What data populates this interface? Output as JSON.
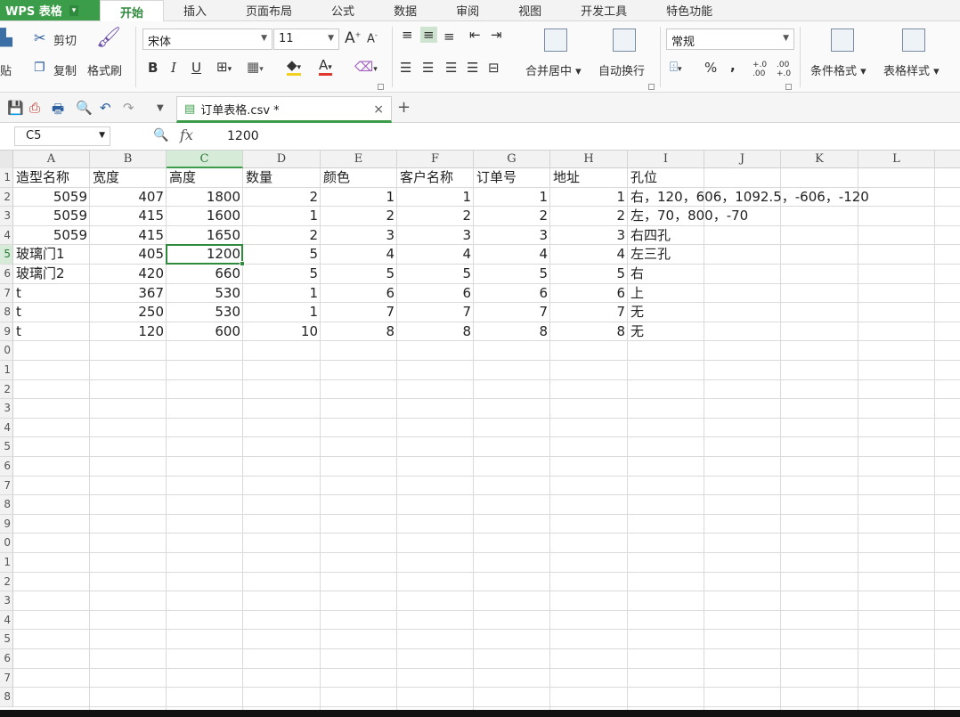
{
  "app": {
    "name": "WPS 表格",
    "caret": "▾"
  },
  "menu_tabs": [
    "开始",
    "插入",
    "页面布局",
    "公式",
    "数据",
    "审阅",
    "视图",
    "开发工具",
    "特色功能"
  ],
  "ribbon": {
    "paste": "贴",
    "cut": "剪切",
    "copy": "复制",
    "format_painter": "格式刷",
    "font_name": "宋体",
    "font_size": "11",
    "grow_font": "A",
    "shrink_font": "A",
    "bold": "B",
    "italic": "I",
    "underline": "U",
    "merge_center": "合并居中",
    "wrap_text": "自动换行",
    "number_format": "常规",
    "percent": "%",
    "comma": ",",
    "inc_decimal": "+.0\n.00",
    "dec_decimal": ".00\n+.0",
    "conditional_format": "条件格式",
    "table_style": "表格样式"
  },
  "doc_tab": {
    "name": "订单表格.csv *",
    "close": "×",
    "new": "+"
  },
  "formula_bar": {
    "cell_ref": "C5",
    "fx": "fx",
    "value": "1200"
  },
  "columns": [
    "A",
    "B",
    "C",
    "D",
    "E",
    "F",
    "G",
    "H",
    "I",
    "J",
    "K",
    "L"
  ],
  "row_numbers": [
    "1",
    "2",
    "3",
    "4",
    "5",
    "6",
    "7",
    "8",
    "9",
    "0",
    "1",
    "2",
    "3",
    "4",
    "5",
    "6",
    "7",
    "8",
    "9",
    "0",
    "1",
    "2",
    "3",
    "4",
    "5",
    "6",
    "7",
    "8"
  ],
  "selected_cell": {
    "col": "C",
    "row": "5"
  },
  "headers": [
    "造型名称",
    "宽度",
    "高度",
    "数量",
    "颜色",
    "客户名称",
    "订单号",
    "地址",
    "孔位"
  ],
  "rows": [
    [
      "5059",
      "407",
      "1800",
      "2",
      "1",
      "1",
      "1",
      "1",
      "右，120，606，1092.5，-606，-120"
    ],
    [
      "5059",
      "415",
      "1600",
      "1",
      "2",
      "2",
      "2",
      "2",
      "左，70，800，-70"
    ],
    [
      "5059",
      "415",
      "1650",
      "2",
      "3",
      "3",
      "3",
      "3",
      "右四孔"
    ],
    [
      "玻璃门1",
      "405",
      "1200",
      "5",
      "4",
      "4",
      "4",
      "4",
      "左三孔"
    ],
    [
      "玻璃门2",
      "420",
      "660",
      "5",
      "5",
      "5",
      "5",
      "5",
      "右"
    ],
    [
      "t",
      "367",
      "530",
      "1",
      "6",
      "6",
      "6",
      "6",
      "上"
    ],
    [
      "t",
      "250",
      "530",
      "1",
      "7",
      "7",
      "7",
      "7",
      "无"
    ],
    [
      "t",
      "120",
      "600",
      "10",
      "8",
      "8",
      "8",
      "8",
      "无"
    ]
  ],
  "colors": {
    "accent": "#3b9d4a",
    "selection": "#2f8a3d"
  }
}
